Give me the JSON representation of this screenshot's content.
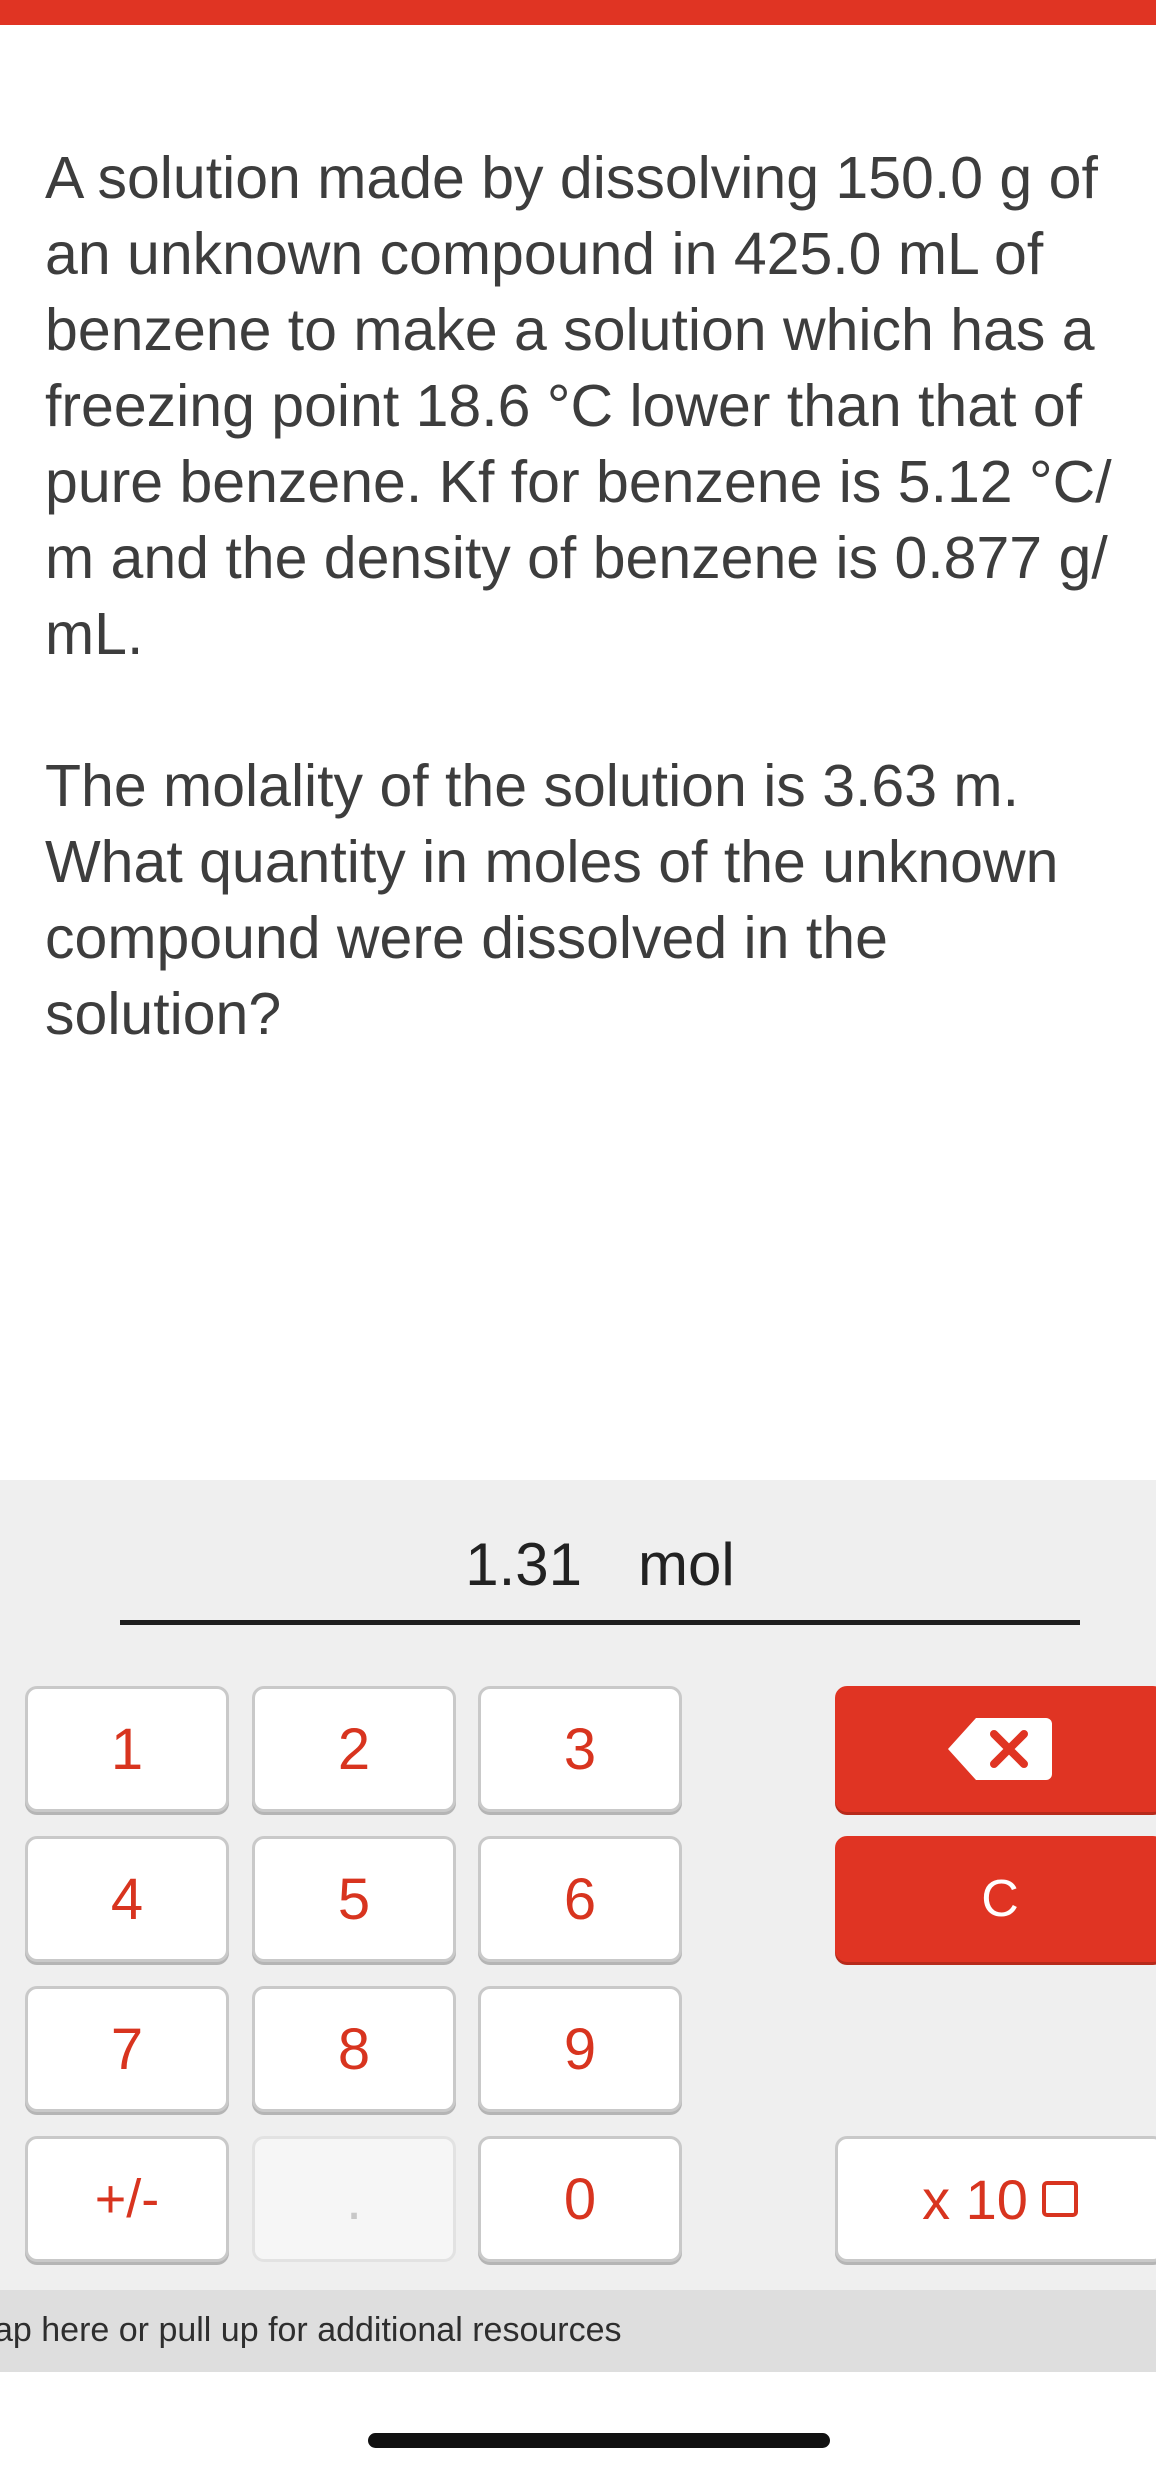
{
  "question": {
    "paragraph1": "A solution made by dissolving 150.0 g of\nan unknown compound in 425.0 mL of\nbenzene to make a solution which has a\nfreezing point 18.6 °C lower than that of\npure benzene. Kf for benzene is 5.12 °C/\nm and the density of benzene is 0.877 g/\nmL.",
    "paragraph2": "The molality of the solution is 3.63 m.\nWhat quantity in moles of the unknown\ncompound were dissolved in the\nsolution?"
  },
  "answer": {
    "value": "1.31",
    "unit": "mol"
  },
  "keypad": {
    "k1": "1",
    "k2": "2",
    "k3": "3",
    "k4": "4",
    "k5": "5",
    "k6": "6",
    "k7": "7",
    "k8": "8",
    "k9": "9",
    "plus_minus": "+/-",
    "decimal": ".",
    "k0": "0",
    "clear": "C",
    "x10": "x 10",
    "backspace_icon": "backspace-icon"
  },
  "resources": {
    "text": "ap here or pull up for additional resources"
  },
  "colors": {
    "accent": "#e03423",
    "keypad_bg": "#efefef"
  }
}
